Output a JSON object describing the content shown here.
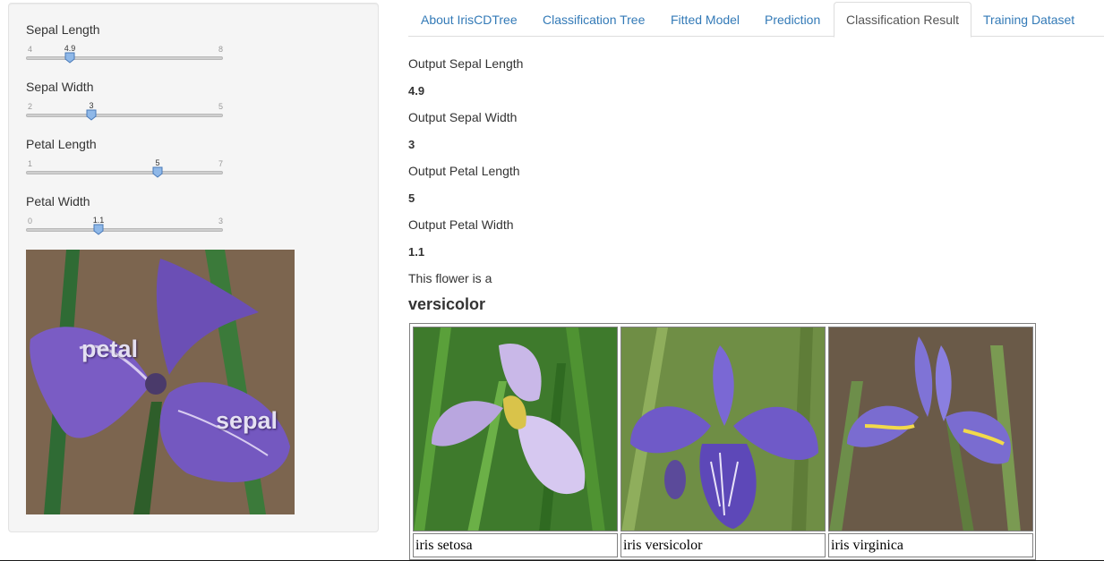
{
  "sidebar": {
    "sliders": [
      {
        "label": "Sepal Length",
        "min": "4",
        "max": "8",
        "value": "4.9",
        "fraction": 0.225
      },
      {
        "label": "Sepal Width",
        "min": "2",
        "max": "5",
        "value": "3",
        "fraction": 0.333
      },
      {
        "label": "Petal Length",
        "min": "1",
        "max": "7",
        "value": "5",
        "fraction": 0.667
      },
      {
        "label": "Petal Width",
        "min": "0",
        "max": "3",
        "value": "1.1",
        "fraction": 0.367
      }
    ],
    "photo": {
      "label_petal": "petal",
      "label_sepal": "sepal"
    }
  },
  "tabs": [
    {
      "label": "About IrisCDTree",
      "active": false
    },
    {
      "label": "Classification Tree",
      "active": false
    },
    {
      "label": "Fitted Model",
      "active": false
    },
    {
      "label": "Prediction",
      "active": false
    },
    {
      "label": "Classification Result",
      "active": true
    },
    {
      "label": "Training Dataset",
      "active": false
    }
  ],
  "result": {
    "outputs": [
      {
        "label": "Output Sepal Length",
        "value": "4.9"
      },
      {
        "label": "Output Sepal Width",
        "value": "3"
      },
      {
        "label": "Output Petal Length",
        "value": "5"
      },
      {
        "label": "Output Petal Width",
        "value": "1.1"
      }
    ],
    "statement": "This flower is a",
    "species": "versicolor",
    "flowers": [
      {
        "caption": "iris setosa"
      },
      {
        "caption": "iris versicolor"
      },
      {
        "caption": "iris virginica"
      }
    ]
  },
  "colors": {
    "accent": "#337ab7",
    "iris_purple": "#7a5cc4",
    "leaf_green": "#3f7a2e"
  }
}
